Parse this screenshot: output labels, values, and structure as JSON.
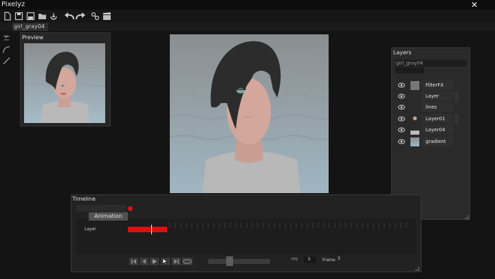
{
  "app": {
    "title": "Pixelyz",
    "close_glyph": "✕"
  },
  "document": {
    "tab_label": "girl_gray04"
  },
  "toolbar": {
    "icons": [
      "new-file-icon",
      "save-icon",
      "save-as-icon",
      "open-folder-icon",
      "import-icon",
      "undo-icon",
      "redo-icon",
      "link-icon",
      "clapper-icon"
    ]
  },
  "left_tools": [
    "select-tool-icon",
    "curve-tool-icon",
    "line-tool-icon"
  ],
  "preview": {
    "title": "Preview"
  },
  "layers": {
    "title": "Layers",
    "document_name": "girl_gray04",
    "items": [
      {
        "name": "FilterFX",
        "thumb": "filter-thumb"
      },
      {
        "name": "Layer",
        "thumb": "hair-thumb"
      },
      {
        "name": "lines",
        "thumb": "lines-thumb"
      },
      {
        "name": "Layer01",
        "thumb": "face-thumb"
      },
      {
        "name": "Layer04",
        "thumb": "body-thumb"
      },
      {
        "name": "gradient",
        "thumb": "gradient-thumb"
      }
    ]
  },
  "timeline": {
    "title": "Timeline",
    "tab_label": "Animation",
    "track_label": "Layer",
    "fps_label": "FPS",
    "fps_value": "5",
    "frame_label": "Frame",
    "frame_value": "3",
    "controls": [
      "first-frame-icon",
      "prev-frame-icon",
      "play-icon",
      "next-frame-icon",
      "last-frame-icon",
      "loop-icon"
    ]
  },
  "colors": {
    "accent_red": "#e01010",
    "record_red": "#d61414",
    "sky_top": "#8a8e90",
    "sky_bottom": "#9fb6c2",
    "hair": "#2d2d2d",
    "skin": "#d3a79c",
    "shirt": "#b8b8b8"
  }
}
